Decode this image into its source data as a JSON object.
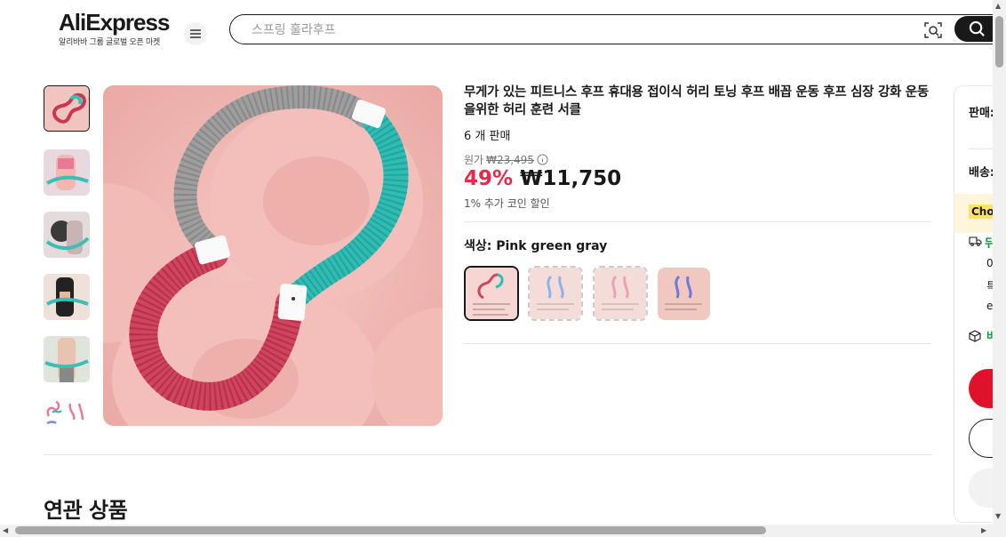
{
  "header": {
    "logo_text": "AliExpress",
    "logo_sub": "알리바바 그룹 글로벌 오픈 마켓",
    "menu_icon": "hamburger-icon",
    "search_placeholder": "스프링 훌라후프",
    "camera_icon": "camera-search-icon",
    "search_icon": "search-icon"
  },
  "product": {
    "title": "무게가 있는 피트니스 후프 휴대용 접이식 허리 토닝 후프 배꼽 운동 후프 심장 강화 운동을위한 허리 훈련 서클",
    "sold": "6 개 판매",
    "original_label": "원가",
    "original_price": "₩23,495",
    "discount": "49%",
    "price": "₩11,750",
    "coin_text": "1% 추가 코인 할인",
    "color_label": "색상: Pink green gray",
    "swatches": [
      "pink-green-gray",
      "blue",
      "pink",
      "purple"
    ],
    "selected_swatch": 0,
    "thumbnails": 6,
    "selected_thumbnail": 0
  },
  "related": {
    "title": "연관 상품"
  },
  "right_panel": {
    "seller": "판매:",
    "shipping": "배송:",
    "choice": "Cho",
    "line1": "뒤",
    "line2": "0",
    "line3": "특",
    "line4": "e",
    "line5": "비"
  },
  "colors": {
    "accent_red": "#e8284a",
    "buy_red": "#e0112b",
    "choice_yellow": "#fff2c4",
    "green": "#0b9b3a"
  }
}
